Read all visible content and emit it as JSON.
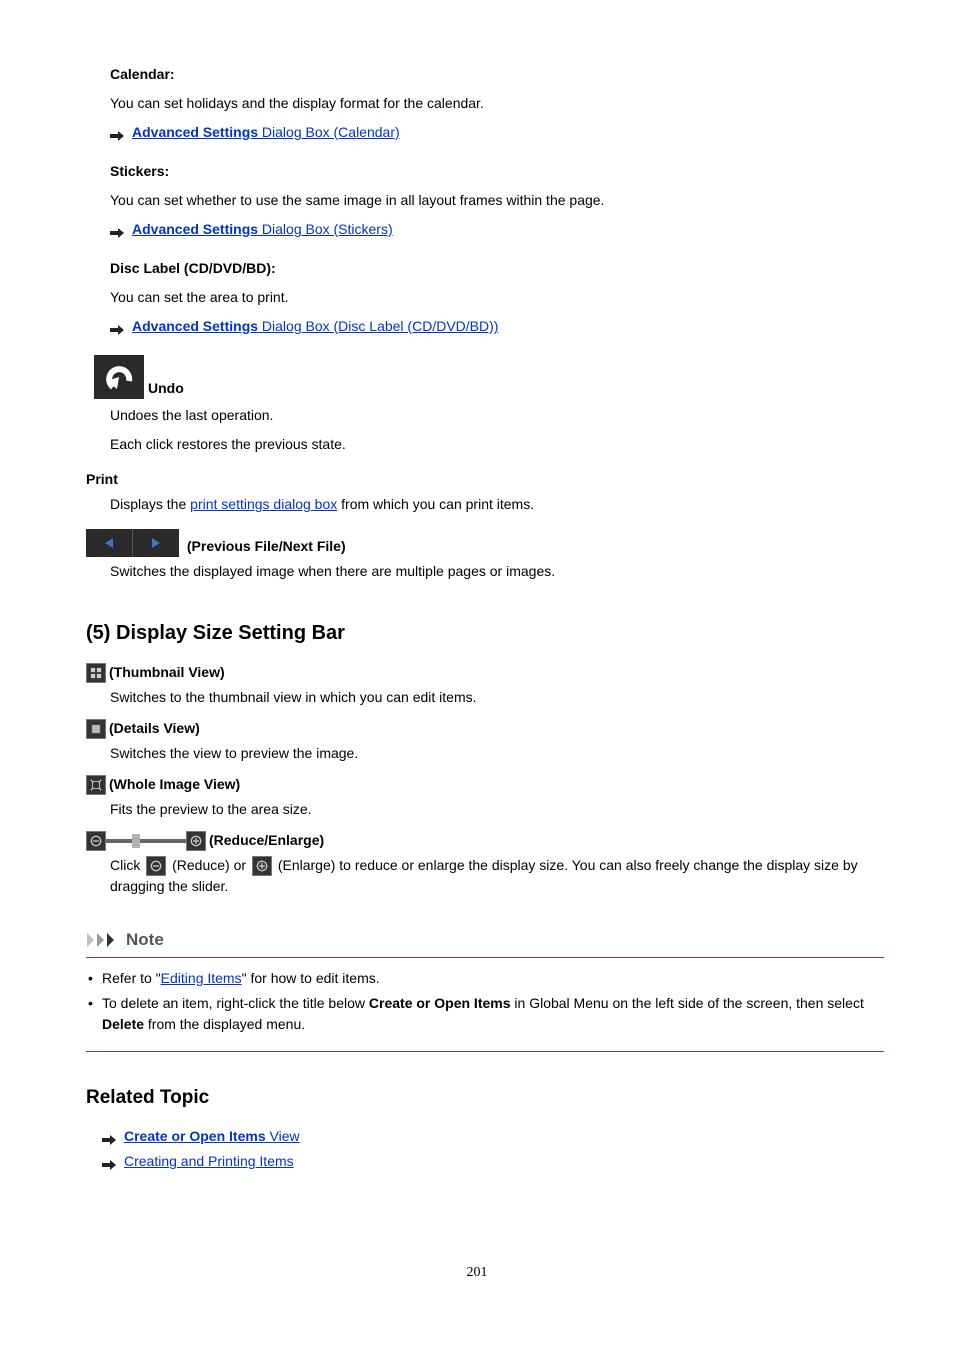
{
  "calendar": {
    "heading": "Calendar:",
    "text": "You can set holidays and the display format for the calendar.",
    "linkBold": "Advanced Settings",
    "linkRest": " Dialog Box (Calendar)"
  },
  "stickers": {
    "heading": "Stickers:",
    "text": "You can set whether to use the same image in all layout frames within the page.",
    "linkBold": "Advanced Settings",
    "linkRest": " Dialog Box (Stickers)"
  },
  "discLabel": {
    "heading": "Disc Label (CD/DVD/BD):",
    "text": "You can set the area to print.",
    "linkBold": "Advanced Settings",
    "linkRest": " Dialog Box (Disc Label (CD/DVD/BD))"
  },
  "undo": {
    "label": "Undo",
    "line1": "Undoes the last operation.",
    "line2": "Each click restores the previous state."
  },
  "print": {
    "label": "Print",
    "pre": "Displays the ",
    "link": "print settings dialog box",
    "post": " from which you can print items."
  },
  "prevNext": {
    "label": " (Previous File/Next File)",
    "text": "Switches the displayed image when there are multiple pages or images."
  },
  "section5": "(5) Display Size Setting Bar",
  "thumbView": {
    "label": " (Thumbnail View)",
    "text": "Switches to the thumbnail view in which you can edit items."
  },
  "detailsView": {
    "label": " (Details View)",
    "text": "Switches the view to preview the image."
  },
  "wholeView": {
    "label": " (Whole Image View)",
    "text": "Fits the preview to the area size."
  },
  "reduceEnlarge": {
    "label": " (Reduce/Enlarge)",
    "pre": "Click ",
    "mid1": " (Reduce) or ",
    "mid2": " (Enlarge) to reduce or enlarge the display size. You can also freely change the display size by dragging the slider."
  },
  "note": {
    "title": "Note",
    "item1pre": "Refer to \"",
    "item1link": "Editing Items",
    "item1post": "\" for how to edit items.",
    "item2a": "To delete an item, right-click the title below ",
    "item2bold1": "Create or Open Items",
    "item2b": " in Global Menu on the left side of the screen, then select ",
    "item2bold2": "Delete",
    "item2c": " from the displayed menu."
  },
  "related": {
    "title": "Related Topic",
    "link1bold": "Create or Open Items",
    "link1rest": " View",
    "link2": "Creating and Printing Items"
  },
  "pageNumber": "201"
}
